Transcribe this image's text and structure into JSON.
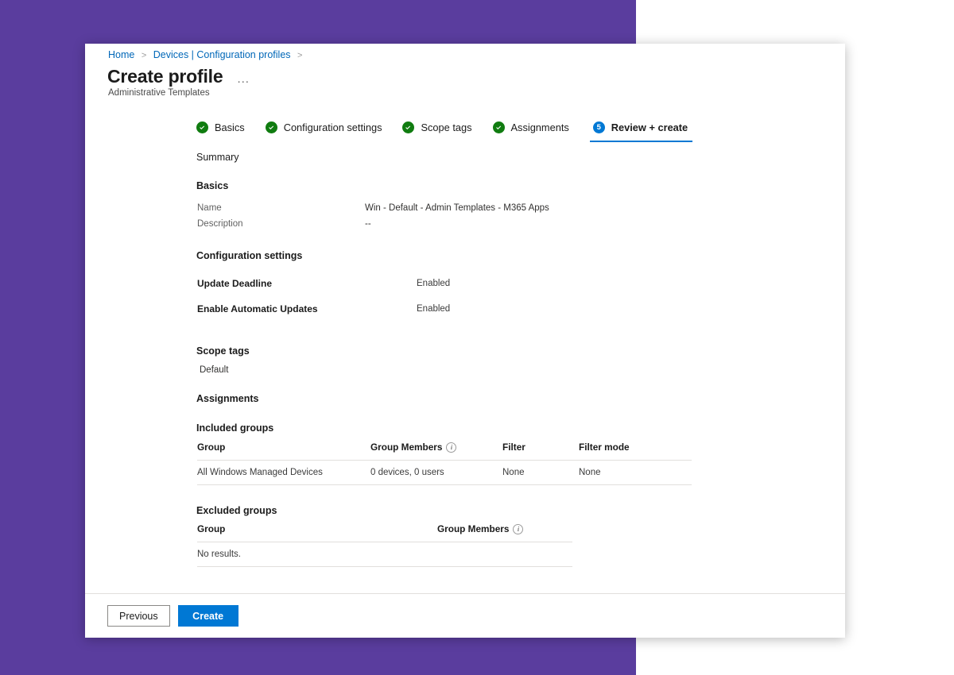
{
  "theme": {
    "background_purple": "#5a3d9e",
    "accent_blue": "#0078d4",
    "link_blue": "#0067b8",
    "success_green": "#107c10"
  },
  "breadcrumb": {
    "items": [
      "Home",
      "Devices | Configuration profiles"
    ],
    "separator": ">"
  },
  "header": {
    "title": "Create profile",
    "more_menu": "...",
    "subtitle": "Administrative Templates"
  },
  "wizard": {
    "steps": [
      {
        "label": "Basics",
        "state": "done",
        "number": "1"
      },
      {
        "label": "Configuration settings",
        "state": "done",
        "number": "2"
      },
      {
        "label": "Scope tags",
        "state": "done",
        "number": "3"
      },
      {
        "label": "Assignments",
        "state": "done",
        "number": "4"
      },
      {
        "label": "Review + create",
        "state": "current",
        "number": "5"
      }
    ]
  },
  "summary": {
    "heading": "Summary",
    "basics": {
      "heading": "Basics",
      "rows": [
        {
          "label": "Name",
          "value": "Win - Default - Admin Templates - M365 Apps"
        },
        {
          "label": "Description",
          "value": "--"
        }
      ]
    },
    "configuration_settings": {
      "heading": "Configuration settings",
      "rows": [
        {
          "label": "Update Deadline",
          "value": "Enabled"
        },
        {
          "label": "Enable Automatic Updates",
          "value": "Enabled"
        }
      ]
    },
    "scope_tags": {
      "heading": "Scope tags",
      "values": [
        "Default"
      ]
    },
    "assignments": {
      "heading": "Assignments",
      "included_groups": {
        "heading": "Included groups",
        "columns": [
          "Group",
          "Group Members",
          "Filter",
          "Filter mode"
        ],
        "rows": [
          {
            "group": "All Windows Managed Devices",
            "group_members": "0 devices, 0 users",
            "filter": "None",
            "filter_mode": "None"
          }
        ]
      },
      "excluded_groups": {
        "heading": "Excluded groups",
        "columns": [
          "Group",
          "Group Members"
        ],
        "empty_message": "No results."
      }
    }
  },
  "footer": {
    "previous_label": "Previous",
    "create_label": "Create"
  }
}
